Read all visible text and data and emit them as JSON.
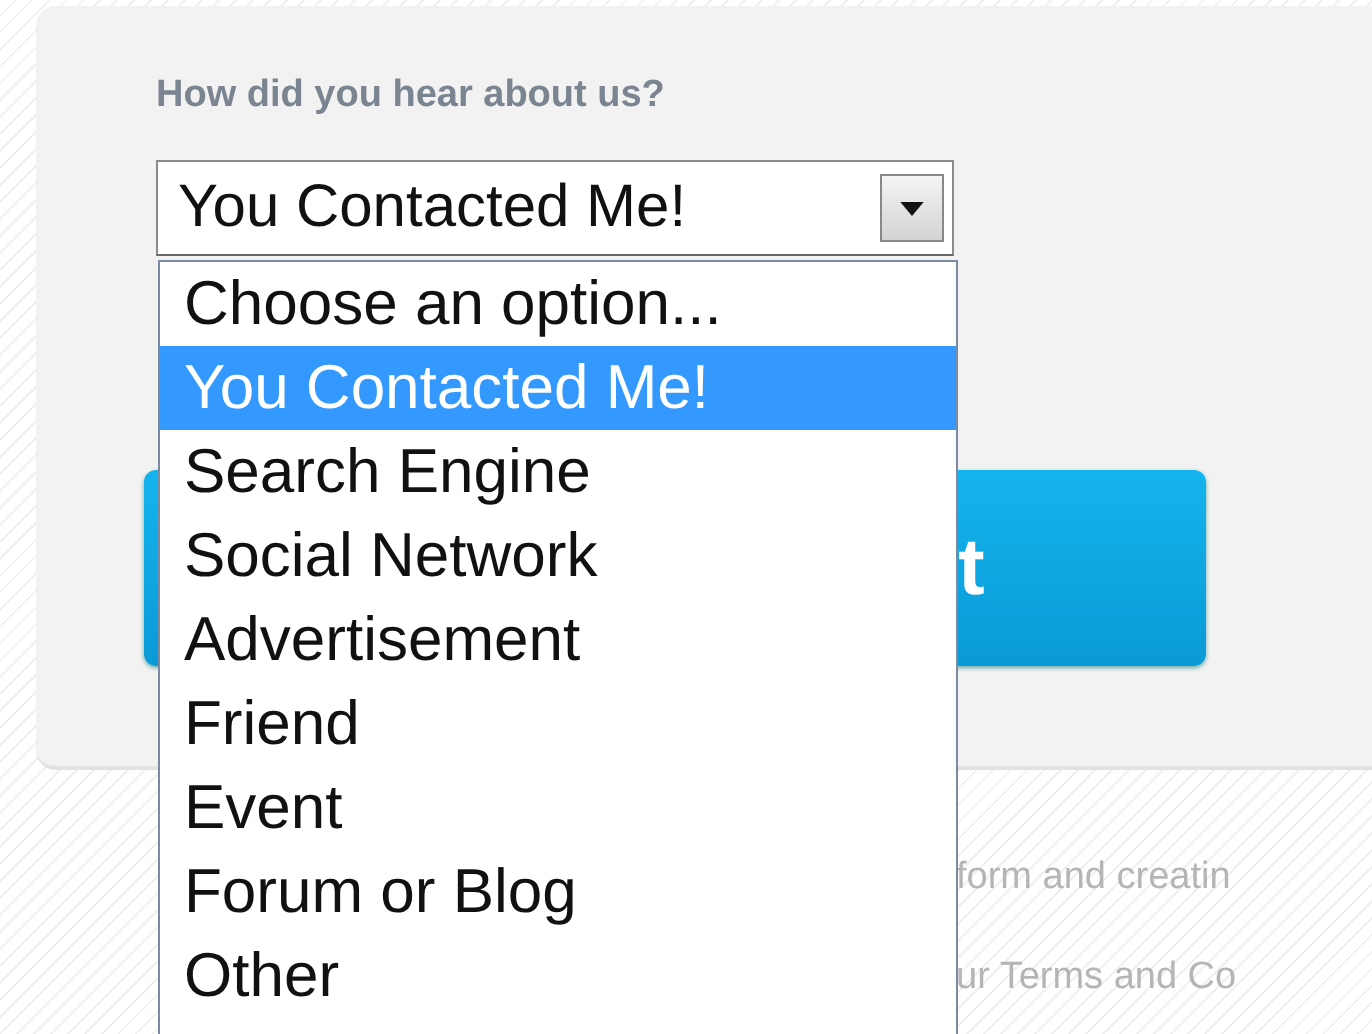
{
  "question": {
    "label": "How did you hear about us?"
  },
  "select": {
    "value": "You Contacted Me!",
    "expanded": true,
    "options": [
      {
        "label": "Choose an option...",
        "selected": false
      },
      {
        "label": "You Contacted Me!",
        "selected": true
      },
      {
        "label": "Search Engine",
        "selected": false
      },
      {
        "label": "Social Network",
        "selected": false
      },
      {
        "label": "Advertisement",
        "selected": false
      },
      {
        "label": "Friend",
        "selected": false
      },
      {
        "label": "Event",
        "selected": false
      },
      {
        "label": "Forum or Blog",
        "selected": false
      },
      {
        "label": "Other",
        "selected": false
      }
    ]
  },
  "button": {
    "label": "t"
  },
  "footer": [
    "form and creatin",
    "ur Terms and Co"
  ]
}
